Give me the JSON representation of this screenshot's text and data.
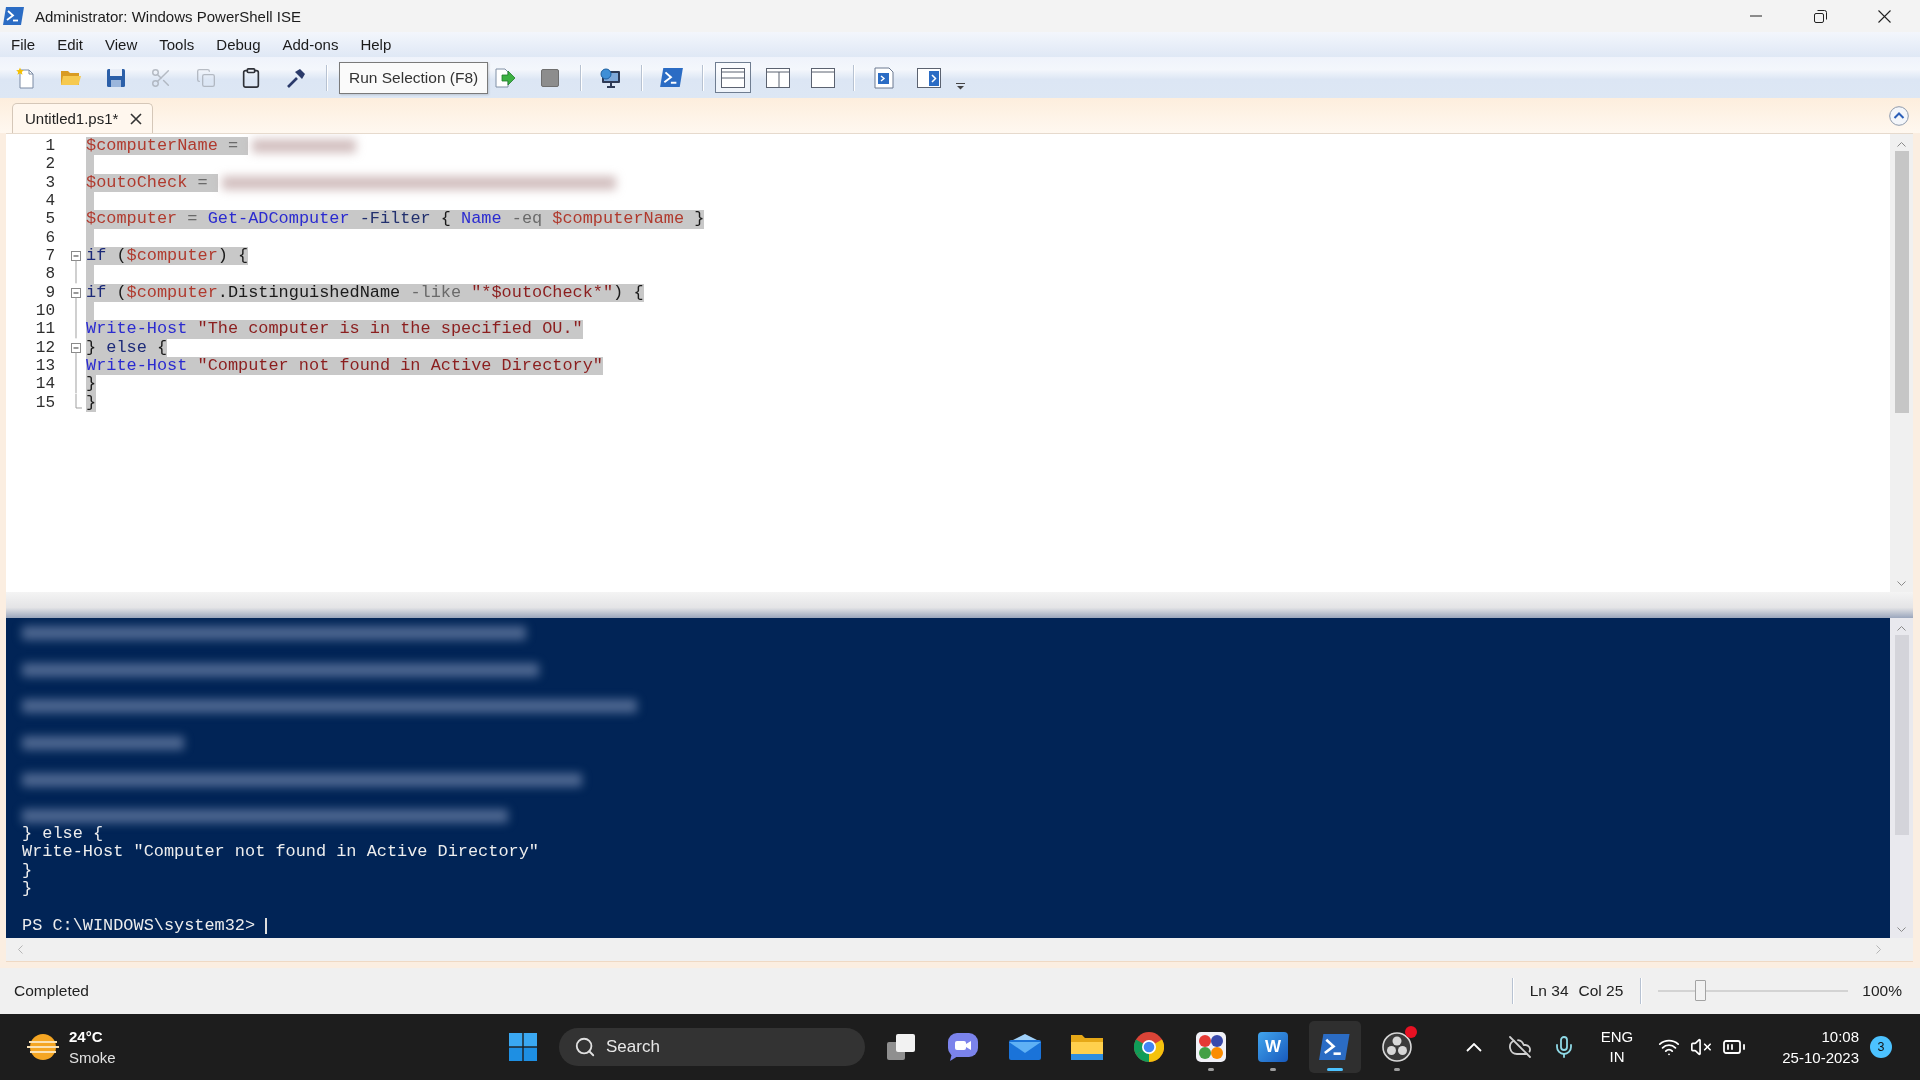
{
  "window": {
    "title": "Administrator: Windows PowerShell ISE"
  },
  "menu": [
    "File",
    "Edit",
    "View",
    "Tools",
    "Debug",
    "Add-ons",
    "Help"
  ],
  "toolbar": {
    "edit_buttons": [
      {
        "disabled": false
      },
      {
        "disabled": false
      },
      {
        "disabled": false
      },
      {
        "disabled": true
      },
      {
        "disabled": true
      },
      {
        "disabled": false
      },
      {
        "disabled": false
      }
    ],
    "tooltip": "Run Selection (F8)",
    "run_buttons": [
      {
        "disabled": false
      },
      {
        "disabled": true
      }
    ],
    "layout_buttons": [
      {
        "selected": true
      },
      {
        "selected": false
      },
      {
        "selected": false
      }
    ]
  },
  "tabs": [
    {
      "label": "Untitled1.ps1*",
      "selected": true
    }
  ],
  "editor": {
    "lines": [
      {
        "number": "1",
        "selected": true,
        "collapsible": false,
        "guide": false,
        "redacted": true,
        "tokens": [
          {
            "kind": "variable",
            "text": "$computerName"
          },
          {
            "kind": "operator",
            "text": " = "
          }
        ]
      },
      {
        "number": "2",
        "selected": true,
        "collapsible": false,
        "guide": false
      },
      {
        "number": "3",
        "selected": true,
        "collapsible": false,
        "guide": false,
        "redacted": true,
        "tokens": [
          {
            "kind": "variable",
            "text": "$outoCheck"
          },
          {
            "kind": "operator",
            "text": " = "
          }
        ]
      },
      {
        "number": "4",
        "selected": true,
        "collapsible": false,
        "guide": false
      },
      {
        "number": "5",
        "selected": true,
        "collapsible": false,
        "guide": false,
        "tokens": [
          {
            "kind": "variable",
            "text": "$computer"
          },
          {
            "kind": "operator",
            "text": " = "
          },
          {
            "kind": "command",
            "text": "Get-ADComputer"
          },
          {
            "kind": "parameter",
            "text": " -Filter"
          },
          {
            "kind": "plain",
            "text": " { "
          },
          {
            "kind": "command",
            "text": "Name"
          },
          {
            "kind": "operator",
            "text": " -eq "
          },
          {
            "kind": "variable",
            "text": "$computerName"
          },
          {
            "kind": "plain",
            "text": " }"
          }
        ]
      },
      {
        "number": "6",
        "selected": true,
        "collapsible": false,
        "guide": false
      },
      {
        "number": "7",
        "selected": true,
        "collapsible": true,
        "guide": false,
        "tokens": [
          {
            "kind": "keyword",
            "text": "if"
          },
          {
            "kind": "plain",
            "text": " ("
          },
          {
            "kind": "variable",
            "text": "$computer"
          },
          {
            "kind": "plain",
            "text": ") {"
          }
        ]
      },
      {
        "number": "8",
        "selected": true,
        "collapsible": false,
        "guide": true
      },
      {
        "number": "9",
        "selected": true,
        "collapsible": true,
        "guide": false,
        "tokens": [
          {
            "kind": "keyword",
            "text": "if"
          },
          {
            "kind": "plain",
            "text": " ("
          },
          {
            "kind": "variable",
            "text": "$computer"
          },
          {
            "kind": "member",
            "text": ".DistinguishedName"
          },
          {
            "kind": "operator",
            "text": " -like "
          },
          {
            "kind": "string",
            "text": "\"*$outoCheck*\""
          },
          {
            "kind": "plain",
            "text": ") {"
          }
        ]
      },
      {
        "number": "10",
        "selected": true,
        "collapsible": false,
        "guide": true
      },
      {
        "number": "11",
        "selected": true,
        "collapsible": false,
        "guide": true,
        "tokens": [
          {
            "kind": "command",
            "text": "Write-Host"
          },
          {
            "kind": "string",
            "text": " \"The computer is in the specified OU.\""
          }
        ]
      },
      {
        "number": "12",
        "selected": true,
        "collapsible": true,
        "guide": false,
        "tokens": [
          {
            "kind": "plain",
            "text": "} "
          },
          {
            "kind": "keyword",
            "text": "else"
          },
          {
            "kind": "plain",
            "text": " {"
          }
        ]
      },
      {
        "number": "13",
        "selected": true,
        "collapsible": false,
        "guide": true,
        "tokens": [
          {
            "kind": "command",
            "text": "Write-Host"
          },
          {
            "kind": "string",
            "text": " \"Computer not found in Active Directory\""
          }
        ]
      },
      {
        "number": "14",
        "selected": true,
        "collapsible": false,
        "guide": true,
        "tokens": [
          {
            "kind": "plain",
            "text": "}"
          }
        ]
      },
      {
        "number": "15",
        "selected": true,
        "collapsible": false,
        "guide": true,
        "tokens": [
          {
            "kind": "plain",
            "text": "}"
          }
        ]
      }
    ]
  },
  "console": {
    "blurred_output": true,
    "lines": [
      "} else {",
      "Write-Host \"Computer not found in Active Directory\"",
      "}",
      "}"
    ],
    "prompt": "PS C:\\WINDOWS\\system32>"
  },
  "status_bar": {
    "status": "Completed",
    "line": "Ln 34",
    "column": "Col 25",
    "zoom": {
      "level": 0.22,
      "reading": "100%"
    }
  },
  "taskbar": {
    "weather": {
      "temperature": "24°C",
      "condition": "Smoke"
    },
    "search": {
      "placeholder": "Search"
    },
    "apps": [
      {
        "kind": "task-view",
        "running": false,
        "selected": false,
        "badge": false
      },
      {
        "kind": "chat",
        "running": false,
        "selected": false,
        "badge": false
      },
      {
        "kind": "mail",
        "running": false,
        "selected": false,
        "badge": false
      },
      {
        "kind": "files",
        "running": false,
        "selected": false,
        "badge": false
      },
      {
        "kind": "browser",
        "running": false,
        "selected": false,
        "badge": false
      },
      {
        "kind": "app-grid",
        "running": true,
        "selected": false,
        "badge": false
      },
      {
        "kind": "word",
        "label": "W",
        "running": true,
        "selected": false,
        "badge": false
      },
      {
        "kind": "powershell",
        "running": true,
        "selected": true,
        "badge": false
      },
      {
        "kind": "recorder",
        "running": true,
        "selected": false,
        "badge": true
      }
    ],
    "tray": {
      "language": "ENG",
      "region": "IN",
      "volume_muted": true,
      "time": "10:08",
      "date": "25-10-2023",
      "notifications": "3"
    }
  }
}
